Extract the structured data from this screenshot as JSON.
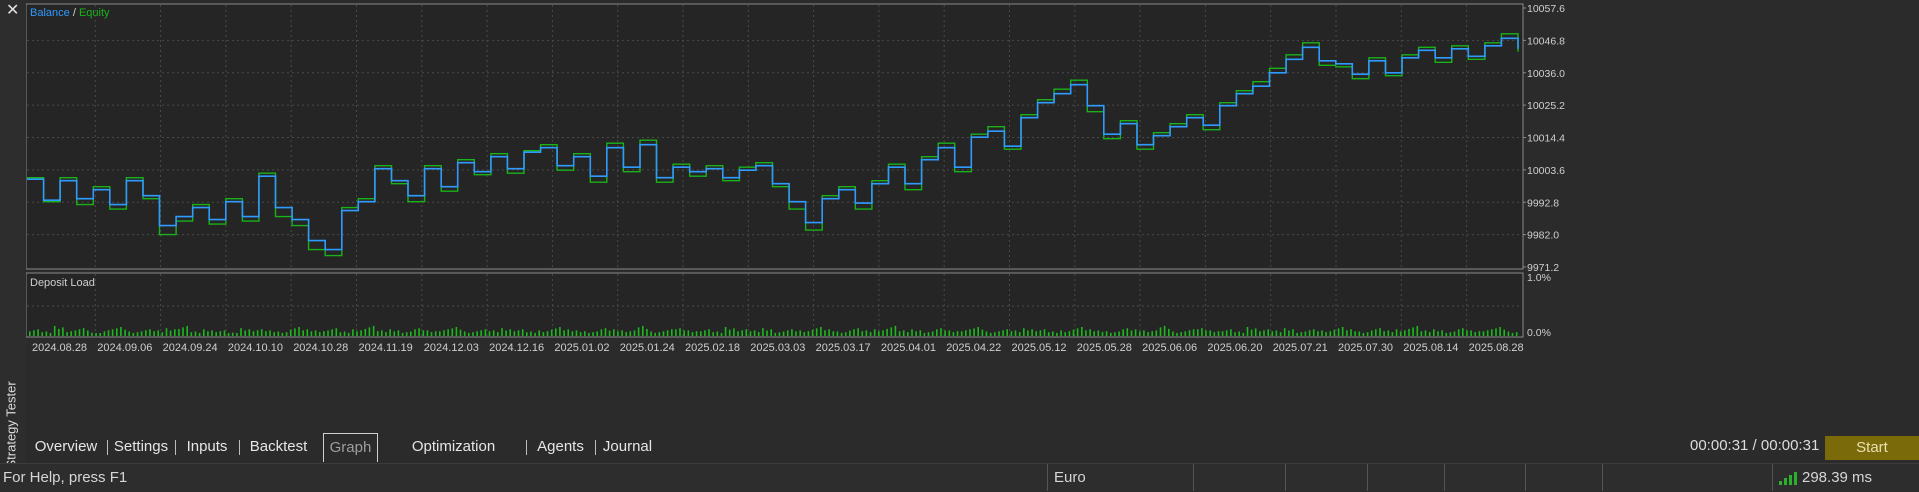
{
  "window": {
    "close_glyph": "✕",
    "panel_label": "Strategy Tester"
  },
  "graph": {
    "legend_balance": "Balance",
    "legend_sep": " / ",
    "legend_equity": "Equity",
    "deposit_load_label": "Deposit Load",
    "deposit_ticks": [
      "1.0%",
      "0.0%"
    ],
    "colors": {
      "background": "#252525",
      "grid": "#4a4a4a",
      "balance": "#2f9bff",
      "equity": "#19b219",
      "deposit_bars": "#1db81d",
      "axis_text": "#cfcfcf"
    }
  },
  "chart_data": [
    {
      "type": "line",
      "title": "",
      "legend": [
        "Balance",
        "Equity"
      ],
      "legend_position": "top-left",
      "grid": true,
      "ylim": [
        9971.2,
        10057.6
      ],
      "y_ticks": [
        "10057.6",
        "10046.8",
        "10036.0",
        "10025.2",
        "10014.4",
        "10003.6",
        "9992.8",
        "9982.0",
        "9971.2"
      ],
      "x_ticks": [
        "2024.08.28",
        "2024.09.06",
        "2024.09.24",
        "2024.10.10",
        "2024.10.28",
        "2024.11.19",
        "2024.12.03",
        "2024.12.16",
        "2025.01.02",
        "2025.01.24",
        "2025.02.18",
        "2025.03.03",
        "2025.03.17",
        "2025.04.01",
        "2025.04.22",
        "2025.05.12",
        "2025.05.28",
        "2025.06.06",
        "2025.06.20",
        "2025.07.21",
        "2025.07.30",
        "2025.08.14",
        "2025.08.28"
      ],
      "series": [
        {
          "name": "Balance",
          "values": [
            10000.5,
            9993.5,
            10000.0,
            9994.0,
            9997.0,
            9992.0,
            10000.0,
            9995.0,
            9985.0,
            9988.0,
            9991.0,
            9987.0,
            9993.0,
            9988.0,
            10001.5,
            9991.0,
            9987.0,
            9980.0,
            9977.0,
            9990.0,
            9993.0,
            10004.0,
            10000.0,
            9995.0,
            10004.0,
            9998.0,
            10006.0,
            10003.0,
            10008.0,
            10004.0,
            10009.5,
            10011.0,
            10005.0,
            10008.0,
            10001.5,
            10011.0,
            10004.5,
            10012.0,
            10001.0,
            10004.5,
            10003.0,
            10004.0,
            10001.0,
            10003.5,
            10005.0,
            9999.0,
            9993.0,
            9986.0,
            9994.0,
            9997.0,
            9992.5,
            9999.0,
            10004.5,
            9999.0,
            10007.0,
            10011.0,
            10004.5,
            10014.5,
            10016.5,
            10011.5,
            10021.0,
            10026.0,
            10029.0,
            10032.0,
            10025.0,
            10015.5,
            10019.0,
            10012.0,
            10015.0,
            10018.0,
            10021.0,
            10018.5,
            10025.0,
            10029.0,
            10031.5,
            10036.0,
            10040.5,
            10044.5,
            10040.0,
            10039.0,
            10035.5,
            10040.0,
            10036.0,
            10041.0,
            10043.5,
            10041.0,
            10044.0,
            10041.5,
            10045.0,
            10047.5,
            10044.0
          ]
        },
        {
          "name": "Equity",
          "values": [
            10001.0,
            9993.0,
            10001.0,
            9992.0,
            9998.0,
            9990.5,
            10001.0,
            9994.0,
            9982.0,
            9986.5,
            9992.0,
            9985.5,
            9994.0,
            9986.5,
            10002.5,
            9988.0,
            9985.0,
            9977.0,
            9975.0,
            9991.0,
            9994.0,
            10005.0,
            9999.0,
            9993.0,
            10005.0,
            9996.5,
            10007.0,
            10002.0,
            10009.0,
            10002.5,
            10010.0,
            10012.0,
            10003.5,
            10009.0,
            9999.5,
            10012.5,
            10003.0,
            10013.5,
            9999.5,
            10005.5,
            10001.5,
            10005.0,
            10000.0,
            10004.5,
            10006.0,
            9998.0,
            9990.5,
            9983.5,
            9995.0,
            9998.0,
            9990.5,
            10000.0,
            10005.5,
            9997.0,
            10008.0,
            10012.5,
            10003.0,
            10015.5,
            10018.0,
            10010.5,
            10022.0,
            10027.0,
            10030.5,
            10033.5,
            10023.0,
            10014.0,
            10020.0,
            10010.5,
            10016.0,
            10019.0,
            10022.0,
            10017.0,
            10026.0,
            10030.0,
            10033.0,
            10037.5,
            10042.0,
            10046.0,
            10038.5,
            10038.0,
            10034.0,
            10041.0,
            10035.0,
            10042.0,
            10044.5,
            10039.5,
            10045.0,
            10040.5,
            10046.0,
            10049.0,
            10043.0
          ]
        }
      ]
    },
    {
      "type": "bar",
      "title": "Deposit Load",
      "ylim": [
        0.0,
        1.0
      ],
      "y_ticks": [
        "1.0%",
        "0.0%"
      ],
      "note_values": "short uniform green bars near 0%, per-trade deposit load",
      "values": [
        0.12,
        0.08,
        0.18,
        0.1,
        0.14,
        0.06,
        0.12,
        0.16,
        0.08,
        0.12,
        0.1,
        0.14,
        0.18,
        0.08,
        0.12,
        0.1,
        0.06,
        0.14,
        0.12,
        0.1,
        0.08,
        0.16,
        0.12,
        0.1,
        0.14,
        0.08,
        0.12,
        0.18,
        0.1,
        0.12,
        0.08,
        0.14,
        0.1,
        0.12,
        0.16,
        0.08,
        0.12,
        0.1,
        0.14,
        0.12,
        0.08,
        0.1,
        0.16,
        0.12,
        0.1,
        0.08,
        0.14,
        0.12,
        0.1,
        0.18,
        0.08,
        0.12,
        0.14,
        0.1,
        0.12,
        0.08,
        0.16,
        0.12,
        0.1,
        0.14,
        0.08,
        0.12,
        0.1,
        0.16,
        0.12,
        0.08,
        0.14,
        0.1,
        0.12,
        0.18,
        0.1,
        0.12,
        0.08,
        0.14,
        0.1,
        0.12,
        0.16,
        0.08,
        0.12,
        0.1,
        0.14,
        0.12,
        0.08,
        0.1,
        0.16,
        0.12,
        0.1,
        0.08,
        0.14,
        0.12,
        0.1,
        0.18,
        0.08,
        0.12,
        0.14,
        0.1,
        0.12,
        0.08,
        0.16,
        0.12,
        0.1,
        0.14,
        0.08,
        0.12,
        0.1,
        0.16,
        0.12,
        0.08,
        0.14,
        0.1,
        0.12,
        0.18,
        0.1,
        0.12,
        0.08,
        0.14,
        0.1,
        0.12,
        0.16,
        0.08
      ]
    }
  ],
  "tabs": [
    {
      "label": "Overview"
    },
    {
      "label": "Settings"
    },
    {
      "label": "Inputs"
    },
    {
      "label": "Backtest"
    },
    {
      "label": "Graph",
      "active": true
    },
    {
      "label": "Optimization Results"
    },
    {
      "label": "Agents"
    },
    {
      "label": "Journal"
    }
  ],
  "timer": "00:00:31 / 00:00:31",
  "start_button": "Start",
  "statusbar": {
    "help": "For Help, press F1",
    "language": "Euro",
    "ping": "298.39 ms"
  }
}
